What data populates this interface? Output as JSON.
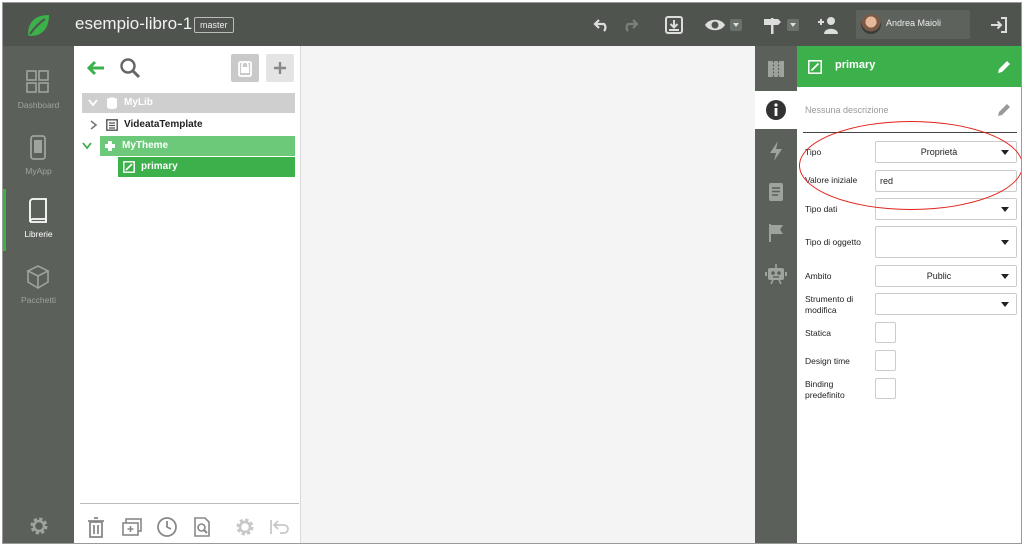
{
  "topbar": {
    "app_title": "esempio-libro-1",
    "branch": "master",
    "user_name": "Andrea Maioli"
  },
  "leftnav": {
    "items": [
      {
        "label": "Dashboard",
        "icon": "dashboard-icon"
      },
      {
        "label": "MyApp",
        "icon": "phone-icon"
      },
      {
        "label": "Librerie",
        "icon": "book-icon",
        "active": true
      },
      {
        "label": "Pacchetti",
        "icon": "package-icon"
      }
    ]
  },
  "tree": {
    "rows": [
      {
        "label": "MyLib",
        "icon": "database-icon"
      },
      {
        "label": "VideataTemplate",
        "icon": "window-icon"
      },
      {
        "label": "MyTheme",
        "icon": "puzzle-icon"
      },
      {
        "label": "primary",
        "icon": "edit-square-icon"
      }
    ]
  },
  "props": {
    "title": "primary",
    "description": "Nessuna descrizione",
    "fields": {
      "tipo": {
        "label": "Tipo",
        "value": "Proprietà"
      },
      "valore_iniziale": {
        "label": "Valore iniziale",
        "value": "red"
      },
      "tipo_dati": {
        "label": "Tipo dati",
        "value": ""
      },
      "tipo_oggetto": {
        "label": "Tipo di oggetto",
        "value": ""
      },
      "ambito": {
        "label": "Ambito",
        "value": "Public"
      },
      "strumento_l1": "Strumento di",
      "strumento_l2": "modifica",
      "strumento_value": "",
      "statica": {
        "label": "Statica"
      },
      "design_time": {
        "label": "Design time"
      },
      "binding_l1": "Binding",
      "binding_l2": "predefinito"
    }
  },
  "colors": {
    "accent_green": "#3cb04a",
    "light_green": "#6cc979",
    "dark_bar": "#4f544f",
    "annotation_red": "#e1221a"
  }
}
